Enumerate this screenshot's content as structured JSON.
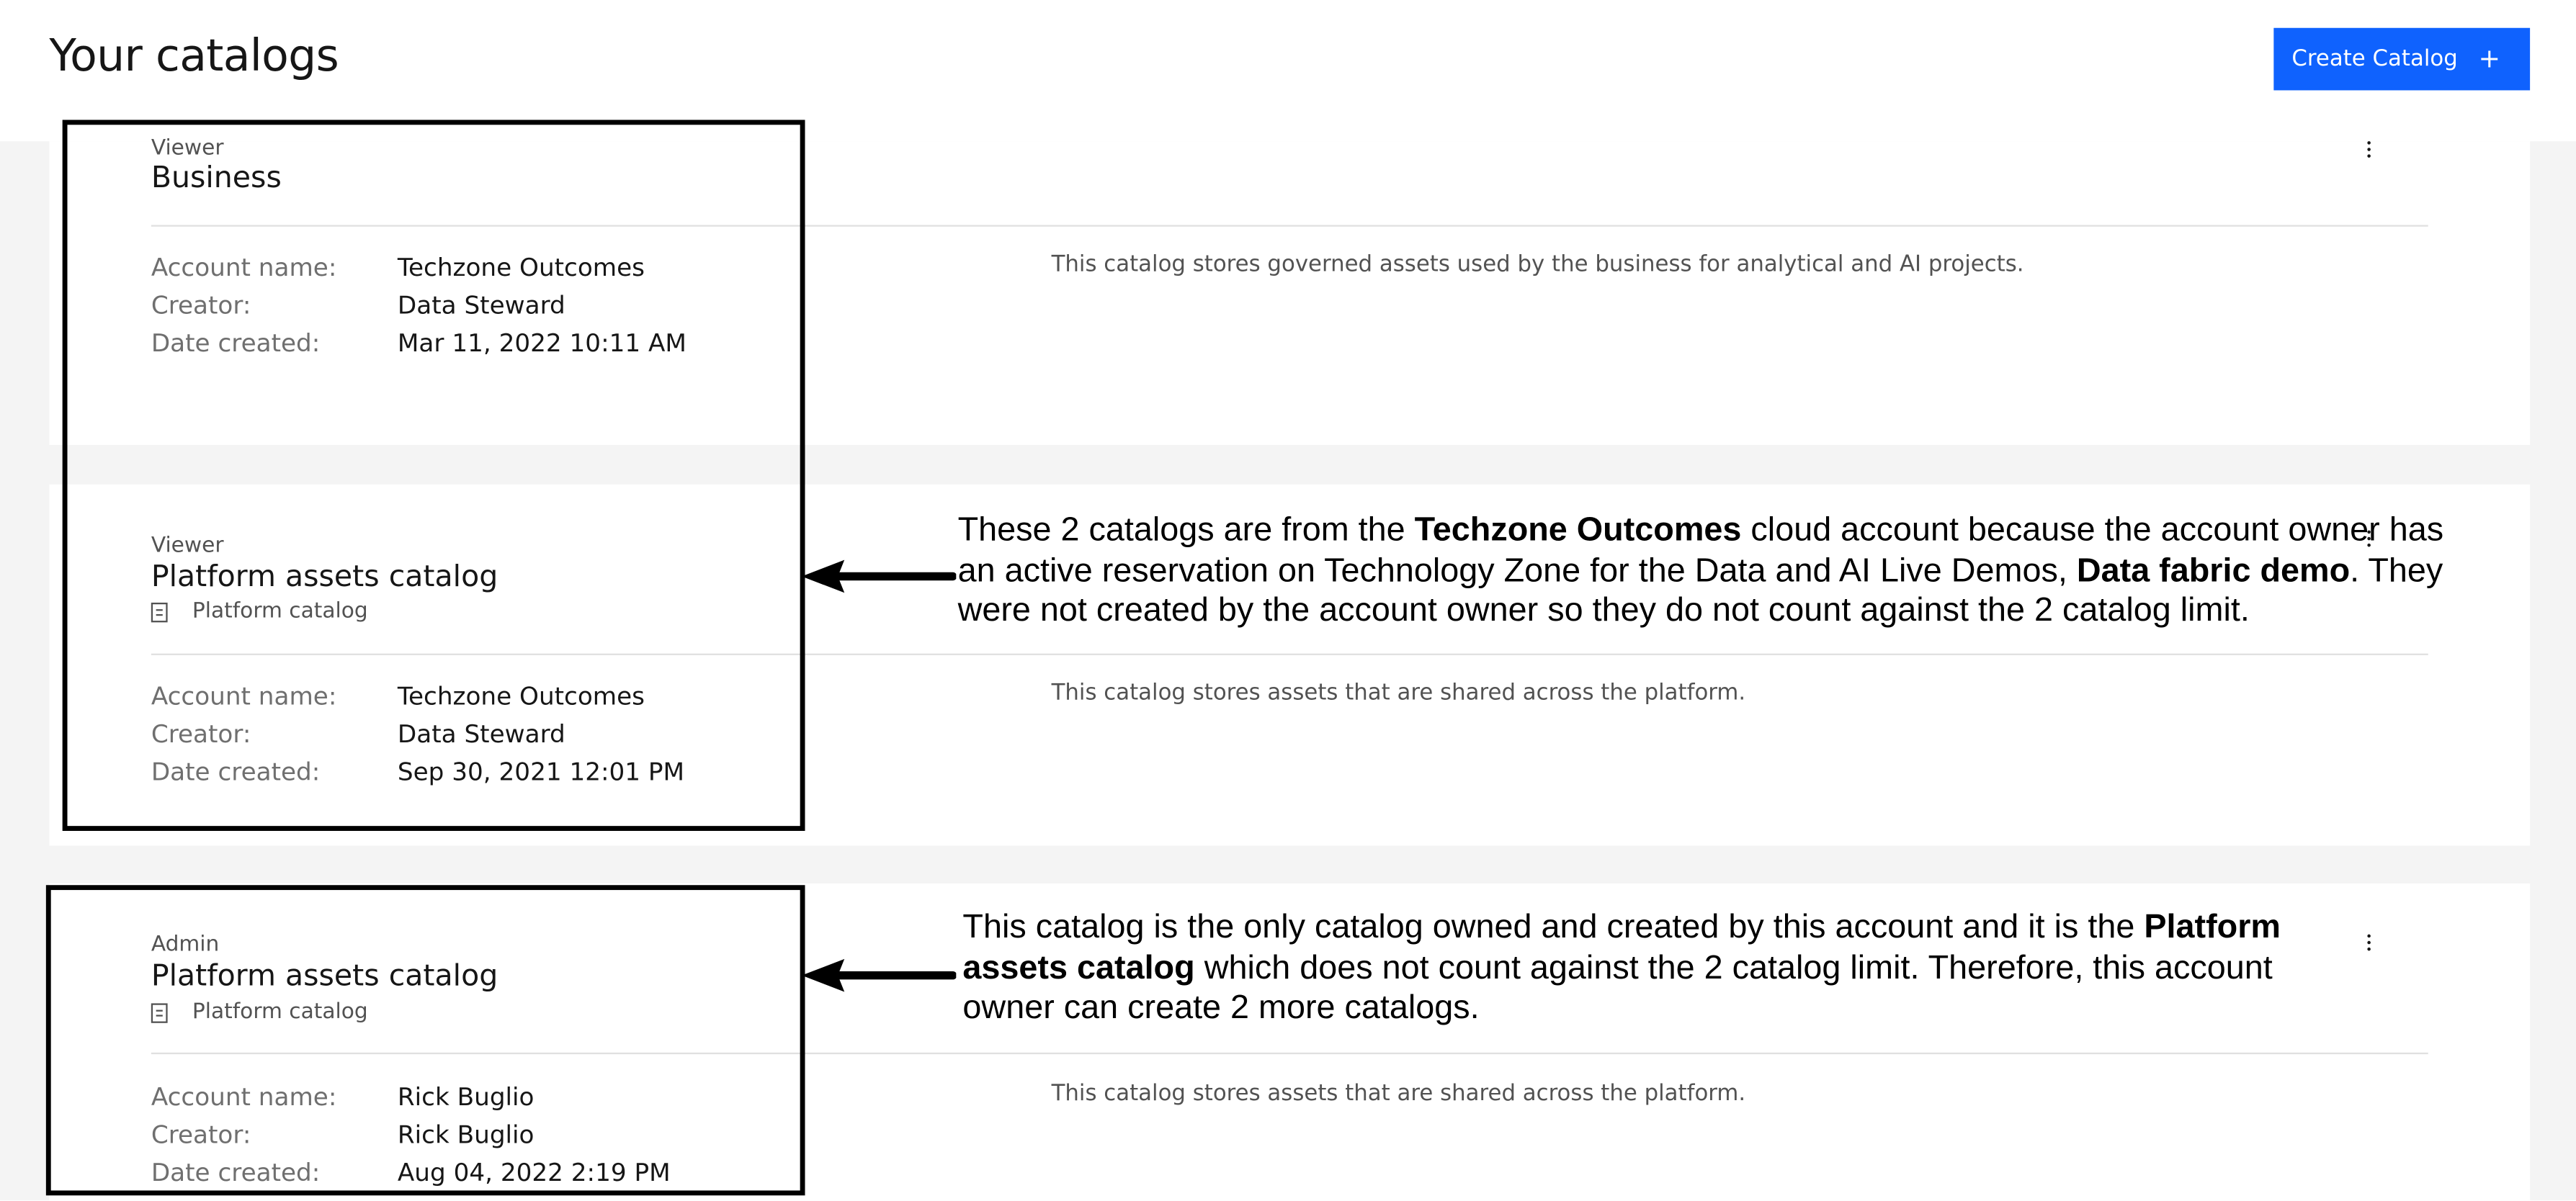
{
  "header": {
    "title": "Your catalogs",
    "create_label": "Create Catalog",
    "create_icon": "+"
  },
  "labels": {
    "account_name": "Account name:",
    "creator": "Creator:",
    "date_created": "Date created:"
  },
  "catalogs": [
    {
      "role": "Viewer",
      "name": "Business",
      "subtype": "",
      "account_name": "Techzone Outcomes",
      "creator": "Data Steward",
      "date_created": "Mar 11, 2022 10:11 AM",
      "description": "This catalog stores governed assets used by the business for analytical and AI projects."
    },
    {
      "role": "Viewer",
      "name": "Platform assets catalog",
      "subtype": "Platform catalog",
      "account_name": "Techzone Outcomes",
      "creator": "Data Steward",
      "date_created": "Sep 30, 2021 12:01 PM",
      "description": "This catalog stores assets that are shared across the platform."
    },
    {
      "role": "Admin",
      "name": "Platform assets catalog",
      "subtype": "Platform catalog",
      "account_name": "Rick Buglio",
      "creator": "Rick Buglio",
      "date_created": "Aug 04, 2022 2:19 PM",
      "description": "This catalog stores assets that are shared across the platform."
    }
  ],
  "annotations": {
    "note1": {
      "t1": "These 2 catalogs are from the ",
      "b1": "Techzone Outcomes",
      "t2": " cloud account because the account owner has an active reservation on Technology Zone for the Data and AI Live Demos, ",
      "b2": "Data fabric demo",
      "t3": ". They were not created by the account owner so they do not count against the 2 catalog limit."
    },
    "note2": {
      "t1": "This catalog is the only catalog owned and created by this account and it is the ",
      "b1": "Platform assets catalog",
      "t2": " which does not count against the 2 catalog limit. Therefore, this account owner can create 2 more catalogs."
    }
  },
  "colors": {
    "primary_button": "#0f62fe",
    "page_background": "#f4f4f4",
    "card_background": "#ffffff",
    "annotation_box": "#000000"
  }
}
